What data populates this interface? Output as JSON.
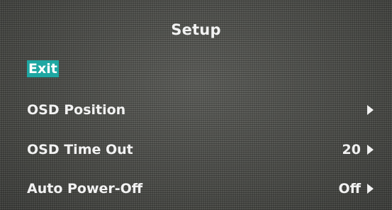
{
  "menu": {
    "title": "Setup",
    "items": [
      {
        "label": "Exit",
        "value": "",
        "has_arrow": false,
        "selected": true
      },
      {
        "label": "OSD Position",
        "value": "",
        "has_arrow": true,
        "selected": false
      },
      {
        "label": "OSD Time Out",
        "value": "20",
        "has_arrow": true,
        "selected": false
      },
      {
        "label": "Auto Power-Off",
        "value": "Off",
        "has_arrow": true,
        "selected": false
      }
    ]
  },
  "colors": {
    "highlight": "#1ea7a2",
    "text": "#f2f2f2",
    "background": "#4a4b48"
  },
  "icons": {
    "submenu_arrow": "right-arrow-icon"
  }
}
